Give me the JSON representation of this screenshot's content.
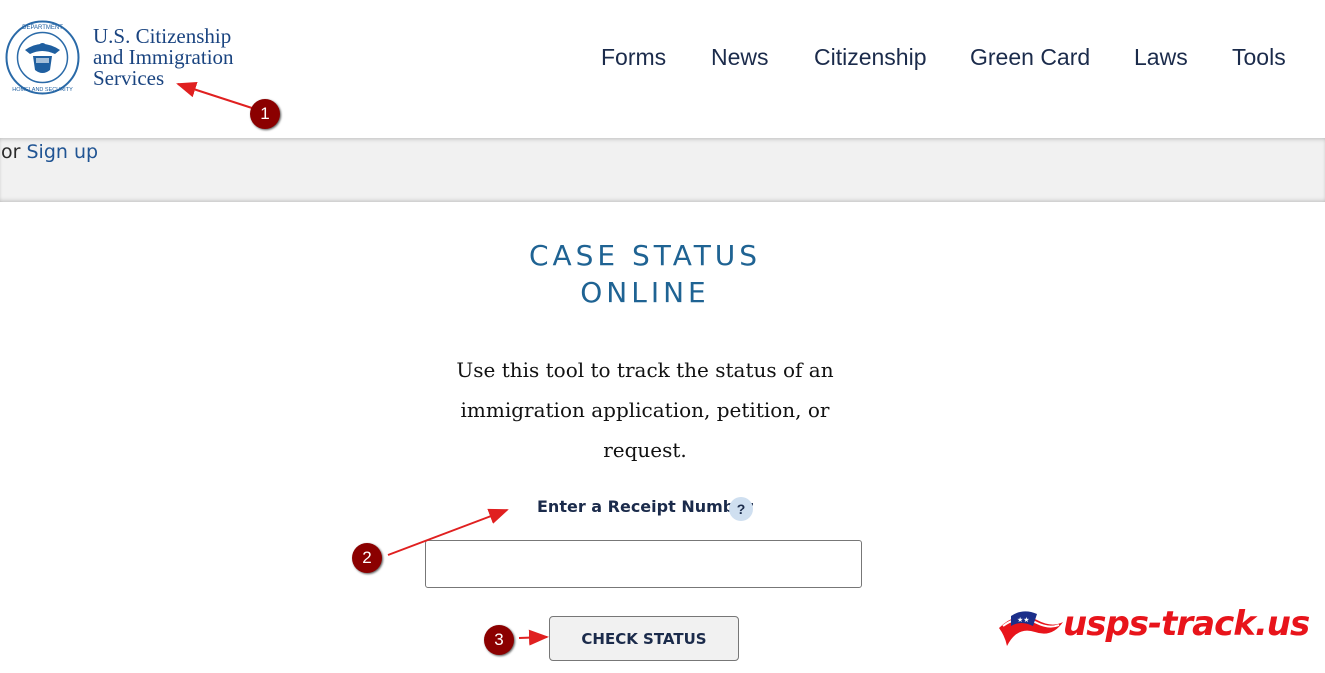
{
  "header": {
    "seal_icon": "dhs-seal-icon",
    "brand_lines": [
      "U.S. Citizenship",
      "and Immigration",
      "Services"
    ],
    "nav": [
      "Forms",
      "News",
      "Citizenship",
      "Green Card",
      "Laws",
      "Tools"
    ]
  },
  "account_band": {
    "or_text": "or",
    "signup_label": "Sign up"
  },
  "main": {
    "title_line1": "CASE STATUS",
    "title_line2": "ONLINE",
    "description": "Use this tool to track the status of an immigration application, petition, or request.",
    "receipt_label": "Enter a Receipt Number",
    "help_icon": "?",
    "receipt_value": "",
    "check_button": "CHECK STATUS"
  },
  "annotations": {
    "badges": [
      "1",
      "2",
      "3"
    ],
    "color": "#8b0000"
  },
  "watermark": {
    "text": "usps-track.us",
    "color": "#e8141b"
  }
}
